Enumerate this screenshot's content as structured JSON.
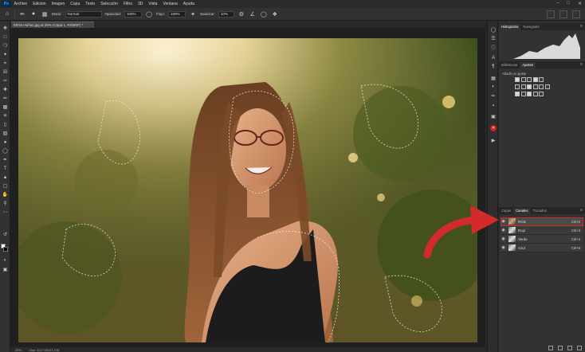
{
  "app": {
    "logo": "Ps"
  },
  "menu": [
    "Archivo",
    "Edición",
    "Imagen",
    "Capa",
    "Texto",
    "Selección",
    "Filtro",
    "3D",
    "Vista",
    "Ventana",
    "Ayuda"
  ],
  "options_bar": {
    "mode_label": "Modo:",
    "mode_value": "Normal",
    "opacity_label": "Opacidad:",
    "opacity_value": "100%",
    "flow_label": "Flujo:",
    "flow_value": "100%",
    "smoothing_label": "Suavizar:",
    "smoothing_value": "10%"
  },
  "document": {
    "tab_title": "Efecto Niños.jpg al 25% (Capa 1, RGB/8*) *",
    "status_zoom": "25%",
    "status_doc": "Doc: 44,7 M/137,3 M"
  },
  "panels": {
    "top_tabs": [
      "Histograma",
      "Navegador"
    ],
    "mid_tabs": [
      "Bibliotecas",
      "Ajustes"
    ],
    "adjust_add_label": "Añadir un ajuste",
    "bottom_tabs": [
      "Capas",
      "Canales",
      "Trazados"
    ],
    "channels": [
      {
        "name": "RGB",
        "shortcut": "Ctrl+2",
        "selected": true,
        "color": true
      },
      {
        "name": "Rojo",
        "shortcut": "Ctrl+3",
        "selected": false,
        "color": false
      },
      {
        "name": "Verde",
        "shortcut": "Ctrl+4",
        "selected": false,
        "color": false
      },
      {
        "name": "Azul",
        "shortcut": "Ctrl+5",
        "selected": false,
        "color": false
      }
    ]
  },
  "colors": {
    "accent_red": "#d42a2a",
    "panel_bg": "#323232",
    "canvas_bg": "#202020"
  },
  "icons": [
    "brush-icon",
    "eye-icon",
    "move-tool-icon",
    "lasso-icon",
    "crop-icon",
    "eyedropper-icon",
    "type-tool-icon",
    "hand-tool-icon",
    "zoom-tool-icon"
  ]
}
